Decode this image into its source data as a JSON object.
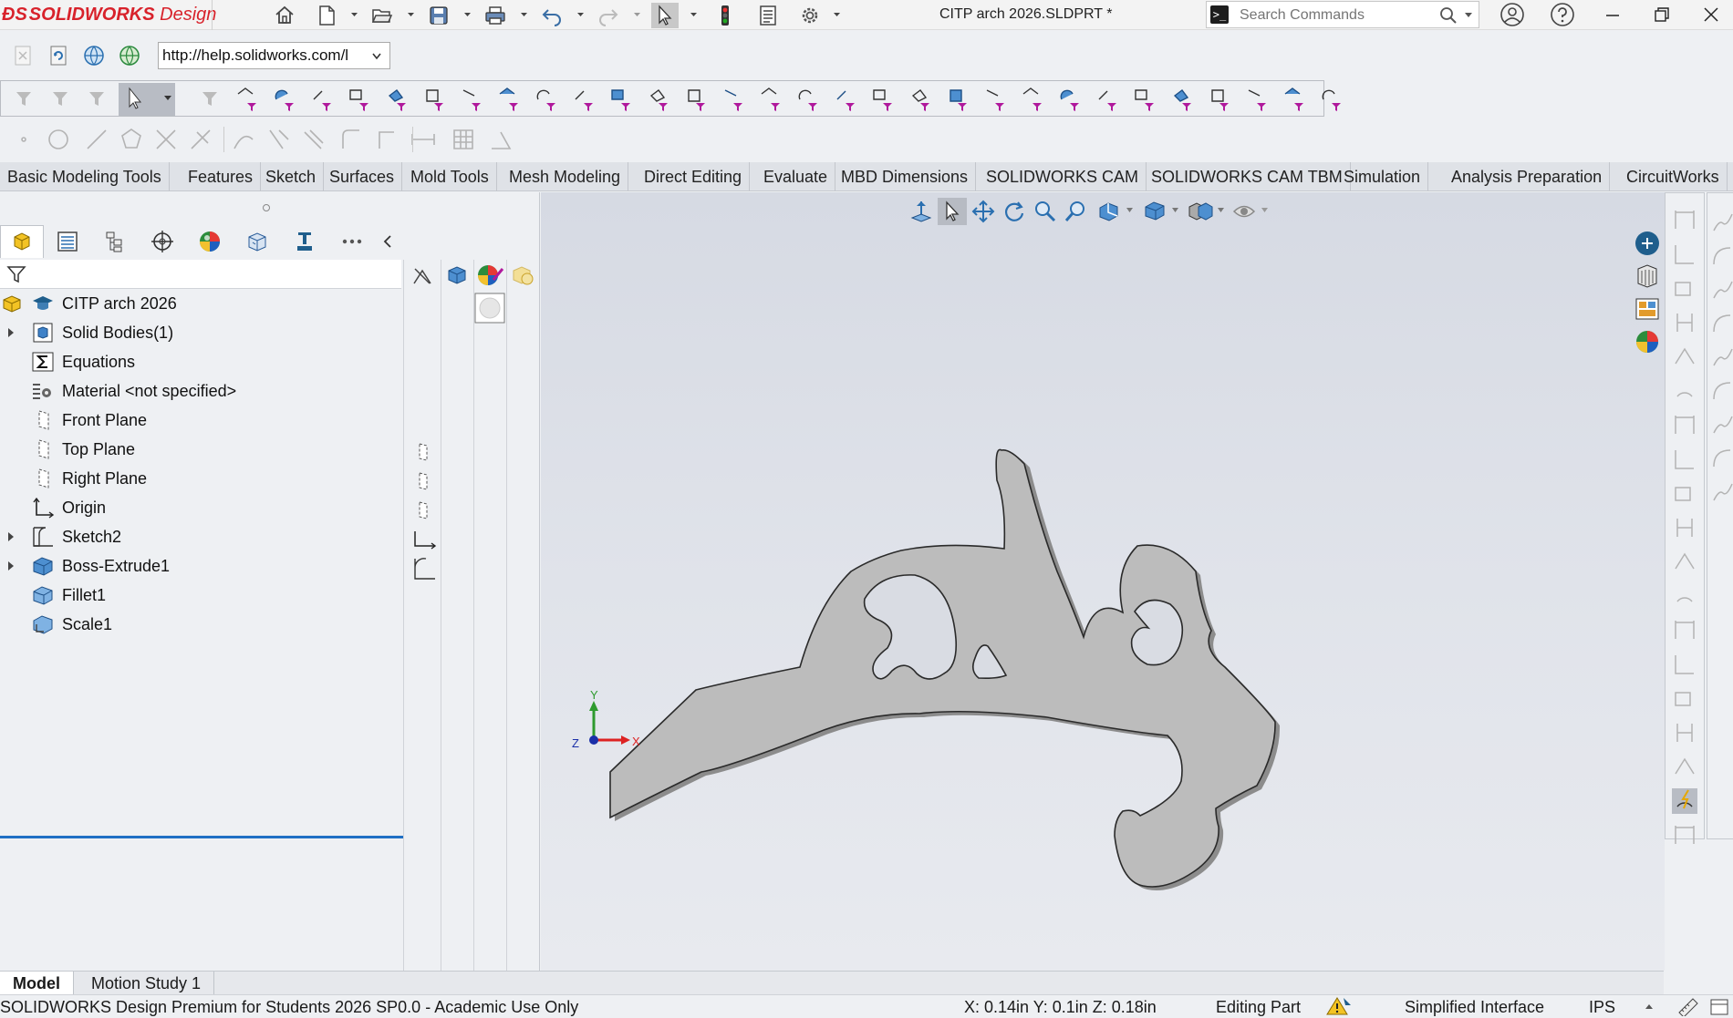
{
  "app": {
    "logo_ds": "ĐS",
    "logo_brand": "SOLIDWORKS",
    "logo_suffix": "Design",
    "document_title": "CITP arch 2026.SLDPRT *"
  },
  "search": {
    "placeholder": "Search Commands"
  },
  "web": {
    "url": "http://help.solidworks.com/l"
  },
  "tabs": [
    "Basic Modeling Tools",
    "Features",
    "Sketch",
    "Surfaces",
    "Mold Tools",
    "Mesh Modeling",
    "Direct Editing",
    "Evaluate",
    "MBD Dimensions",
    "SOLIDWORKS CAM",
    "SOLIDWORKS CAM TBM",
    "Simulation",
    "Analysis Preparation",
    "CircuitWorks"
  ],
  "feature_tree": {
    "items": [
      {
        "label": "CITP arch 2026",
        "icon": "part-icon",
        "expandable": false
      },
      {
        "label": "Solid Bodies(1)",
        "icon": "solid-bodies-icon",
        "expandable": true
      },
      {
        "label": "Equations",
        "icon": "equations-icon",
        "expandable": false
      },
      {
        "label": "Material <not specified>",
        "icon": "material-icon",
        "expandable": false
      },
      {
        "label": "Front Plane",
        "icon": "plane-icon",
        "expandable": false
      },
      {
        "label": "Top Plane",
        "icon": "plane-icon",
        "expandable": false
      },
      {
        "label": "Right Plane",
        "icon": "plane-icon",
        "expandable": false
      },
      {
        "label": "Origin",
        "icon": "origin-icon",
        "expandable": false
      },
      {
        "label": "Sketch2",
        "icon": "sketch-icon",
        "expandable": true
      },
      {
        "label": "Boss-Extrude1",
        "icon": "extrude-icon",
        "expandable": true
      },
      {
        "label": "Fillet1",
        "icon": "fillet-icon",
        "expandable": false
      },
      {
        "label": "Scale1",
        "icon": "scale-icon",
        "expandable": false
      }
    ]
  },
  "bottom_tabs": [
    "Model",
    "Motion Study 1"
  ],
  "status": {
    "product": "SOLIDWORKS Design Premium for Students 2026 SP0.0 - Academic Use Only",
    "coords": "X: 0.14in Y: 0.1in Z: 0.18in",
    "mode": "Editing Part",
    "interface": "Simplified Interface",
    "units": "IPS"
  },
  "triad": {
    "x": "X",
    "y": "Y",
    "z": "Z"
  },
  "colors": {
    "brand_red": "#d8222b",
    "rollback_blue": "#1f6fc4",
    "part_gray": "#bcbcbc",
    "filter_magenta": "#b0199c"
  }
}
